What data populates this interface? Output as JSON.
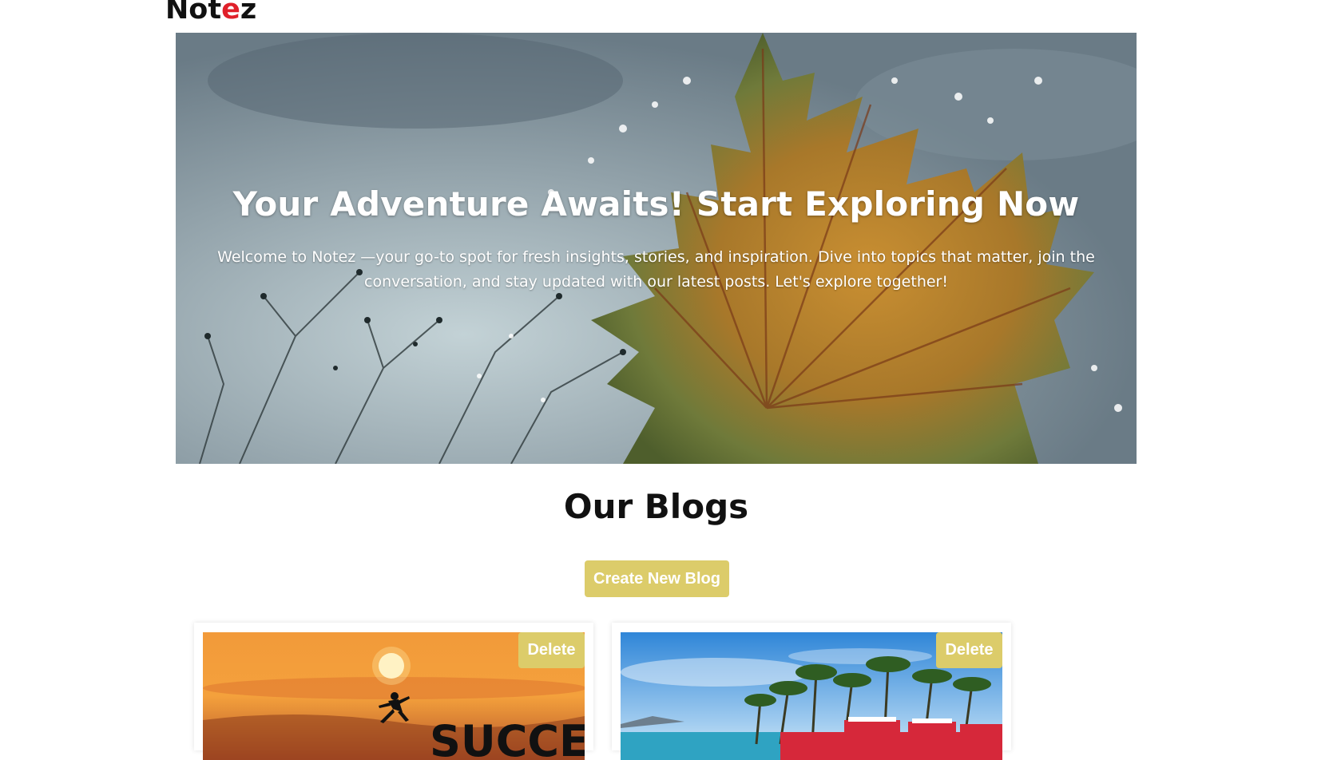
{
  "brand": {
    "logo_prefix": "Not",
    "logo_accent": "e",
    "logo_suffix": "z",
    "accent_color": "#e0202a"
  },
  "hero": {
    "title": "Your Adventure Awaits! Start Exploring Now",
    "subtitle": "Welcome to Notez —your go-to spot for fresh insights, stories, and inspiration. Dive into topics that matter, join the conversation, and stay updated with our latest posts. Let's explore together!",
    "image": "autumn-leaf-image"
  },
  "blogs": {
    "heading": "Our Blogs",
    "create_label": "Create New Blog",
    "button_color": "#dccc6a",
    "cards": [
      {
        "image": "success-sunset-image",
        "image_text": "SUCCESS",
        "delete_label": "Delete"
      },
      {
        "image": "tropical-beach-image",
        "delete_label": "Delete"
      }
    ]
  }
}
